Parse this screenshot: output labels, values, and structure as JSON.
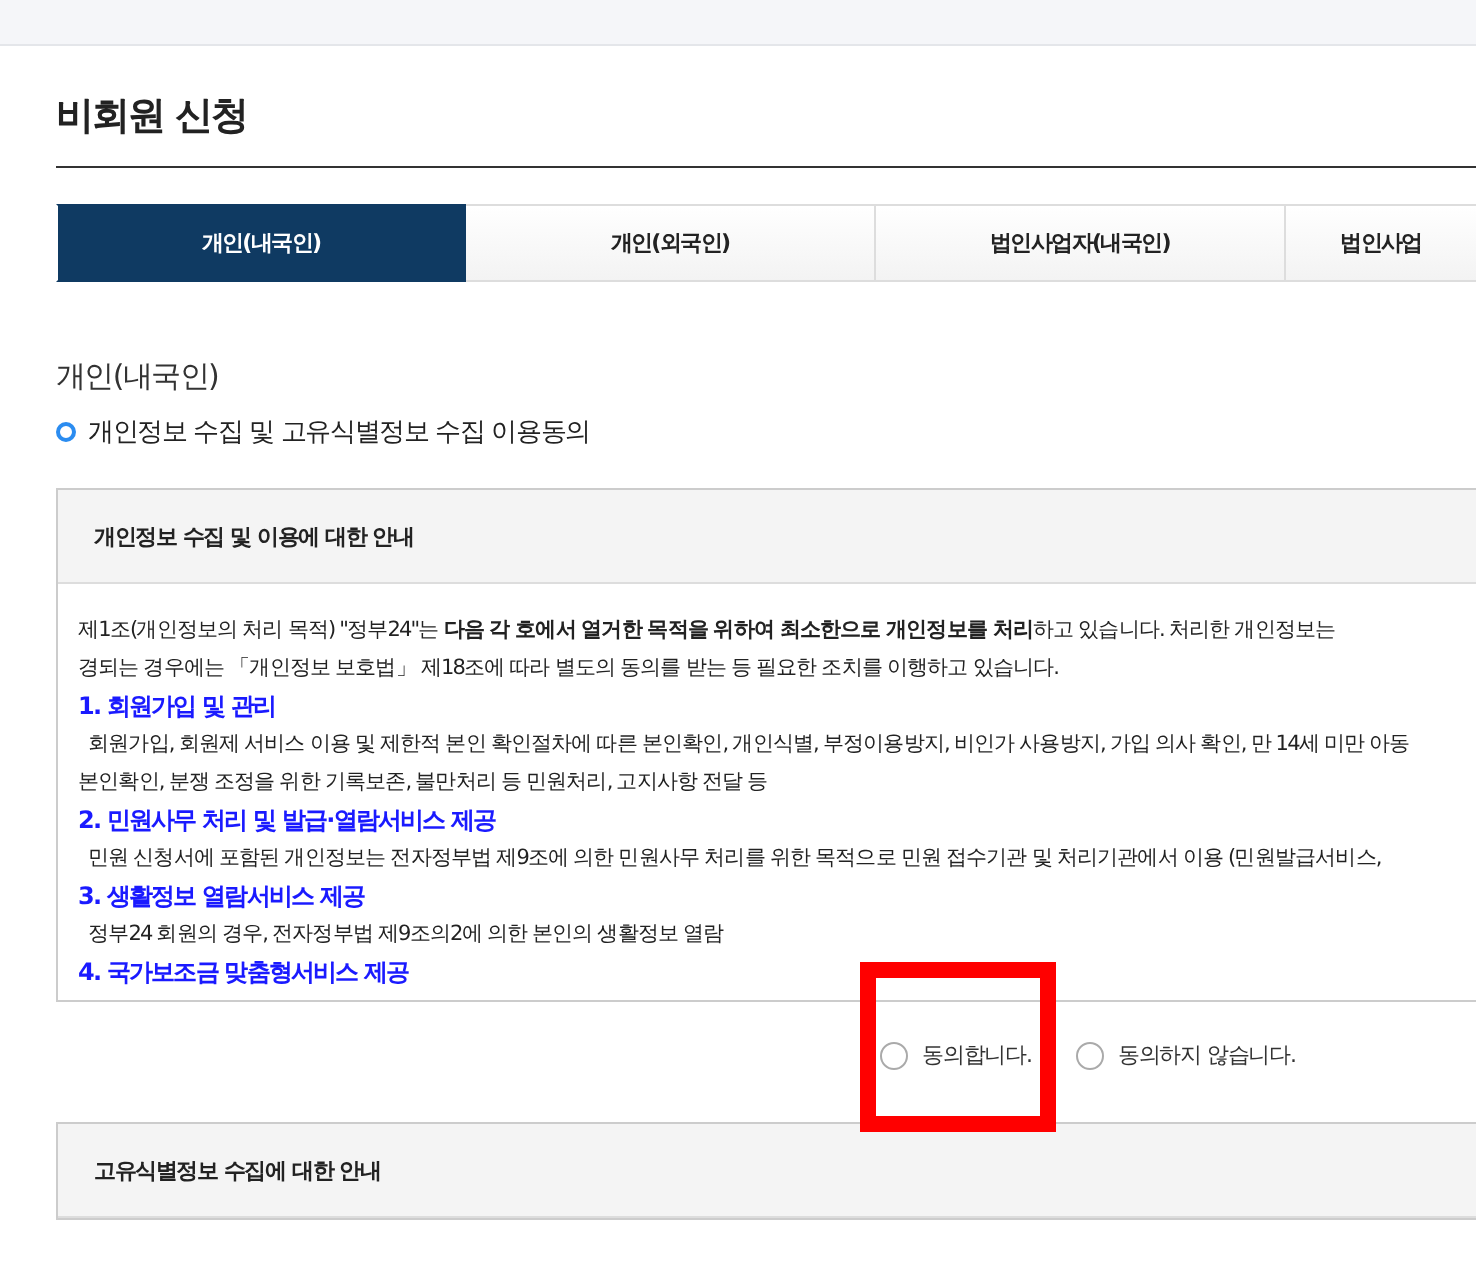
{
  "page_title": "비회원 신청",
  "tabs": [
    {
      "label": "개인(내국인)",
      "selected": true
    },
    {
      "label": "개인(외국인)",
      "selected": false
    },
    {
      "label": "법인사업자(내국인)",
      "selected": false
    },
    {
      "label": "법인사업",
      "selected": false
    }
  ],
  "section_title": "개인(내국인)",
  "consent_title": "개인정보 수집 및 고유식별정보 수집 이용동의",
  "boxes": [
    {
      "title": "개인정보 수집 및 이용에 대한 안내",
      "lines": [
        {
          "kind": "text",
          "text": "제1조(개인정보의 처리 목적) \"정부24\"는 **다음 각 호에서 열거한 목적을 위하여 최소한으로 개인정보를 처리**하고 있습니다. 처리한 개인정보는"
        },
        {
          "kind": "text",
          "text": "경되는 경우에는 「개인정보 보호법」 제18조에 따라 별도의 동의를 받는 등 필요한 조치를 이행하고 있습니다."
        },
        {
          "kind": "heading",
          "text": "1. 회원가입 및 관리"
        },
        {
          "kind": "indent",
          "text": "회원가입, 회원제 서비스 이용 및 제한적 본인 확인절차에 따른 본인확인, 개인식별, 부정이용방지, 비인가 사용방지, 가입 의사 확인, 만 14세 미만 아동"
        },
        {
          "kind": "text",
          "text": "본인확인, 분쟁 조정을 위한 기록보존, 불만처리 등 민원처리, 고지사항 전달 등"
        },
        {
          "kind": "heading",
          "text": "2. 민원사무 처리 및 발급·열람서비스 제공"
        },
        {
          "kind": "indent",
          "text": "민원 신청서에 포함된 개인정보는 전자정부법 제9조에 의한 민원사무 처리를 위한 목적으로 민원 접수기관 및 처리기관에서 이용 (민원발급서비스,"
        },
        {
          "kind": "heading",
          "text": "3. 생활정보 열람서비스 제공"
        },
        {
          "kind": "indent",
          "text": "정부24 회원의 경우, 전자정부법 제9조의2에 의한 본인의 생활정보 열람"
        },
        {
          "kind": "heading",
          "text": "4. 국가보조금 맞춤형서비스 제공"
        }
      ],
      "options": [
        {
          "label": "동의합니다.",
          "selected": false,
          "highlighted": true
        },
        {
          "label": "동의하지 않습니다.",
          "selected": false,
          "highlighted": false
        }
      ]
    },
    {
      "title": "고유식별정보 수집에 대한 안내"
    }
  ]
}
